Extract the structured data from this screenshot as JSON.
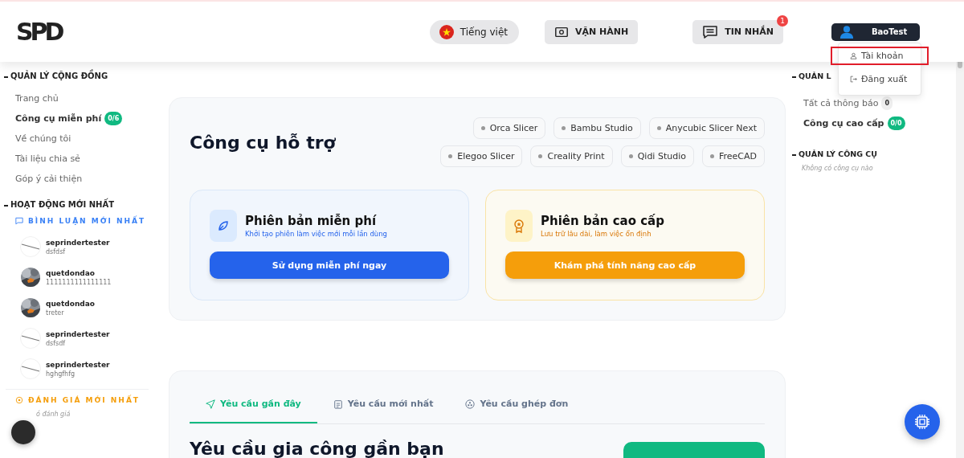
{
  "logo": "SPD",
  "header": {
    "language": "Tiếng việt",
    "operate": "VẬN HÀNH",
    "messages": {
      "label": "TIN NHẮN",
      "badge": "1"
    },
    "user": "BaoTest"
  },
  "user_menu": [
    {
      "label": "Tài khoản",
      "kind": "account",
      "selected": true
    },
    {
      "label": "Đăng xuất",
      "kind": "logout",
      "selected": false
    }
  ],
  "left_sidebar": {
    "community": {
      "title": "QUẢN LÝ CỘNG ĐỒNG",
      "items": [
        {
          "label": "Trang chủ",
          "selected": false
        },
        {
          "label": "Công cụ miễn phí",
          "selected": true,
          "badge": "0/6"
        },
        {
          "label": "Về chúng tôi",
          "selected": false
        },
        {
          "label": "Tài liệu chia sẻ",
          "selected": false
        },
        {
          "label": "Góp ý cải thiện",
          "selected": false
        }
      ]
    },
    "activity": {
      "title": "HOẠT ĐỘNG MỚI NHẤT",
      "comments_title": "BÌNH LUẬN MỚI NHẤT",
      "comments": [
        {
          "user": "seprindertester",
          "text": "dsfdsf",
          "kind": "line"
        },
        {
          "user": "quetdondao",
          "text": "1111111111111111",
          "kind": "picture"
        },
        {
          "user": "quetdondao",
          "text": "treter",
          "kind": "picture"
        },
        {
          "user": "seprindertester",
          "text": "dsfsdf",
          "kind": "line"
        },
        {
          "user": "seprindertester",
          "text": "hghgfhfg",
          "kind": "line"
        }
      ],
      "reviews_title": "ĐÁNH GIÁ MỚI NHẤT",
      "reviews_empty": "ó đánh giá"
    }
  },
  "tools": {
    "title": "Công cụ hỗ trợ",
    "chips": [
      "Orca Slicer",
      "Bambu Studio",
      "Anycubic Slicer Next",
      "Elegoo Slicer",
      "Creality Print",
      "Qidi Studio",
      "FreeCAD"
    ],
    "plans": [
      {
        "kind": "free",
        "title": "Phiên bản miễn phí",
        "subtitle": "Khởi tạo phiên làm việc mới mỗi lần dùng",
        "button": "Sử dụng miễn phí ngay"
      },
      {
        "kind": "premium",
        "title": "Phiên bản cao cấp",
        "subtitle": "Lưu trữ lâu dài, làm việc ổn định",
        "button": "Khám phá tính năng cao cấp"
      }
    ]
  },
  "requests": {
    "tabs": [
      {
        "label": "Yêu cầu gần đây",
        "kind": "send",
        "selected": true
      },
      {
        "label": "Yêu cầu mới nhất",
        "kind": "clipboard",
        "selected": false
      },
      {
        "label": "Yêu cầu ghép đơn",
        "kind": "group",
        "selected": false
      }
    ],
    "title": "Yêu cầu gia công gần bạn"
  },
  "right_sidebar": {
    "title": "QUẢN L",
    "items": [
      {
        "label": "Tất cả thông báo",
        "badge": "0",
        "selected": false
      },
      {
        "label": "Công cụ cao cấp",
        "badge": "0/0",
        "selected": true
      }
    ],
    "tools_title": "QUẢN LÝ CÔNG CỤ",
    "tools_empty": "Không có công cụ nào"
  }
}
